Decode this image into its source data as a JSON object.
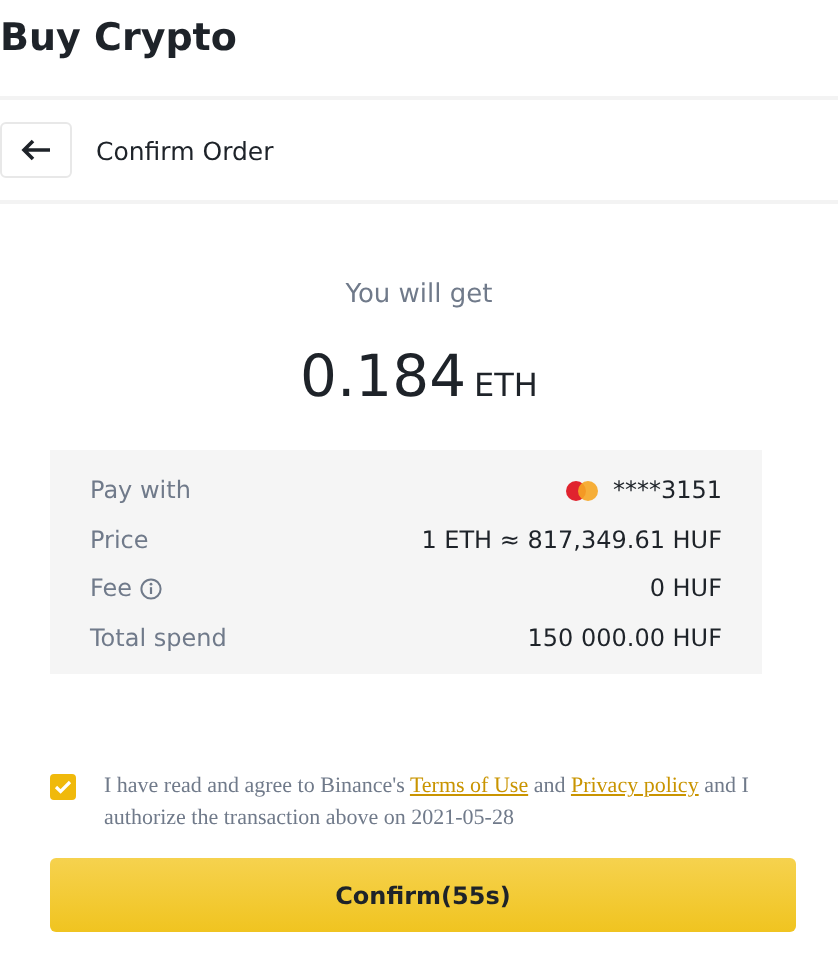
{
  "page_title": "Buy Crypto",
  "header": {
    "title": "Confirm Order"
  },
  "receive": {
    "label": "You will get",
    "amount": "0.184",
    "unit": "ETH"
  },
  "summary": [
    {
      "kind": "card",
      "label": "Pay with",
      "value": "****3151"
    },
    {
      "kind": "plain",
      "label": "Price",
      "value": "1 ETH ≈ 817,349.61 HUF"
    },
    {
      "kind": "info",
      "label": "Fee",
      "value": "0 HUF"
    },
    {
      "kind": "plain",
      "label": "Total spend",
      "value": "150 000.00 HUF"
    }
  ],
  "agreement": {
    "checked": true,
    "parts": [
      {
        "kind": "text",
        "text": "I have read and agree to Binance's "
      },
      {
        "kind": "link",
        "text": "Terms of Use"
      },
      {
        "kind": "text",
        "text": " and "
      },
      {
        "kind": "link",
        "text": "Privacy policy"
      },
      {
        "kind": "text",
        "text": " and I authorize the transaction above on 2021-05-28"
      }
    ]
  },
  "confirm_button": "Confirm(55s)"
}
